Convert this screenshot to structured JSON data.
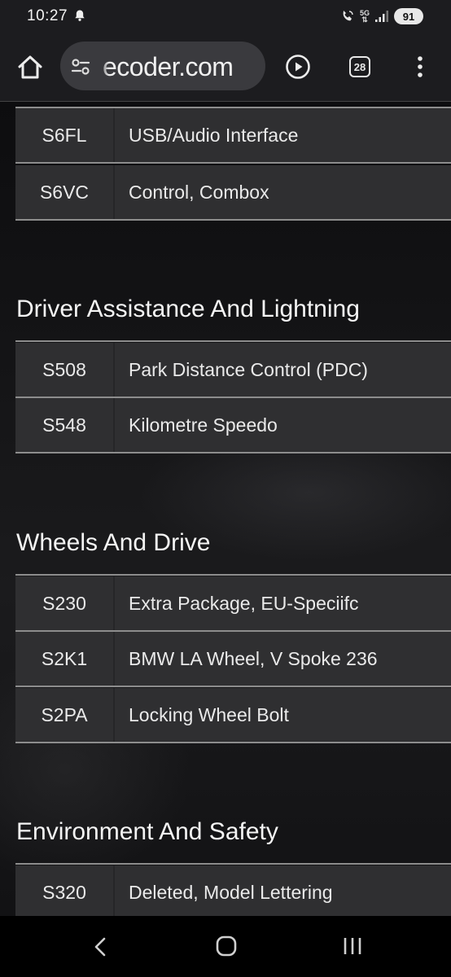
{
  "status_bar": {
    "time": "10:27",
    "network": "5G",
    "battery": "91"
  },
  "browser": {
    "url": "ecoder.com",
    "tab_count": "28"
  },
  "sections": [
    {
      "heading": "",
      "rows": [
        {
          "code": "S6FL",
          "desc": "USB/Audio Interface"
        },
        {
          "code": "S6VC",
          "desc": "Control, Combox"
        }
      ]
    },
    {
      "heading": "Driver Assistance And Lightning",
      "rows": [
        {
          "code": "S508",
          "desc": "Park Distance Control (PDC)"
        },
        {
          "code": "S548",
          "desc": "Kilometre Speedo"
        }
      ]
    },
    {
      "heading": "Wheels And Drive",
      "rows": [
        {
          "code": "S230",
          "desc": "Extra Package, EU-Speciifc"
        },
        {
          "code": "S2K1",
          "desc": "BMW LA Wheel, V Spoke 236"
        },
        {
          "code": "S2PA",
          "desc": "Locking Wheel Bolt"
        }
      ]
    },
    {
      "heading": "Environment And Safety",
      "rows": [
        {
          "code": "S320",
          "desc": "Deleted, Model Lettering"
        }
      ]
    }
  ],
  "colors": {
    "row_bg": "#2f2f31",
    "rule": "#8d8d8d",
    "toolbar_bg": "#1c1c1f"
  }
}
